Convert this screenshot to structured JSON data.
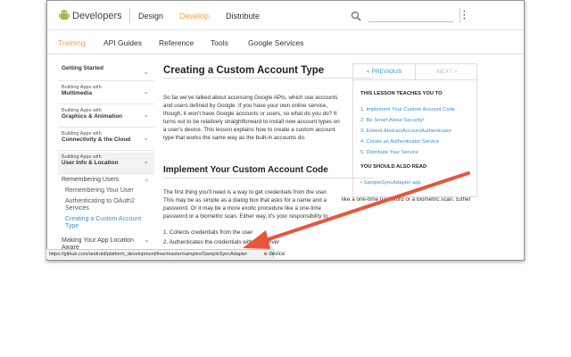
{
  "header": {
    "brand": "Developers",
    "nav": [
      "Design",
      "Develop",
      "Distribute"
    ],
    "active_nav": "Develop"
  },
  "subnav": {
    "items": [
      "Training",
      "API Guides",
      "Reference",
      "Tools",
      "Google Services"
    ],
    "active": "Training"
  },
  "sidebar": {
    "sections": [
      {
        "label": "Getting Started"
      },
      {
        "small": "Building Apps with",
        "bold": "Multimedia"
      },
      {
        "small": "Building Apps with",
        "bold": "Graphics & Animation"
      },
      {
        "small": "Building Apps with",
        "bold": "Connectivity & the Cloud"
      },
      {
        "small": "Building Apps with",
        "bold": "User Info & Location"
      }
    ],
    "sub_header": "Remembering Users",
    "sub_items": [
      "Remembering Your User",
      "Authenticating to OAuth2 Services",
      "Creating a Custom Account Type"
    ],
    "last": "Making Your App Location Aware"
  },
  "content": {
    "title": "Creating a Custom Account Type",
    "intro": "So far we've talked about accessing Google APIs, which use accounts and users defined by Google. If you have your own online service, though, it won't have Google accounts or users, so what do you do? It turns out to be relatively straightforward to install new account types on a user's device. This lesson explains how to create a custom account type that works the same way as the built-in accounts do.",
    "h2": "Implement Your Custom Account Code",
    "para2": "The first thing you'll need is a way to get credentials from the user. This may be as simple as a dialog box that asks for a name and a password. Or it may be a more exotic procedure like a one-time password or a biometric scan. Either way, it's your responsibility to implement the code that",
    "line_tail1": "like a one-time password or a biometric scan. Either",
    "list": [
      "1.  Collects credentials from the user",
      "2.  Authenticates the credentials with the server"
    ],
    "list_tail": "e device"
  },
  "right_panel": {
    "prev": "< PREVIOUS",
    "next": "NEXT >",
    "lesson_title": "THIS LESSON TEACHES YOU TO",
    "lessons": [
      "1.  Implement Your Custom Account Code",
      "2.  Be Smart About Security!",
      "3.  Extend AbstractAccountAuthenticator",
      "4.  Create an Authenticator Service",
      "5.  Distribute Your Service"
    ],
    "also_read_title": "YOU SHOULD ALSO READ",
    "also_read": [
      "•  SampleSyncAdapter app"
    ]
  },
  "status": {
    "url": "https://github.com/android/platform_development/tree/master/samples/SampleSyncAdapter"
  },
  "colors": {
    "accent_orange": "#f1a244",
    "link_blue": "#3a8ed8",
    "arrow_red": "#e8553c",
    "android_green": "#97c03e"
  },
  "icons": [
    "android-logo-icon",
    "search-icon",
    "overflow-menu-icon",
    "chevron-down-icon",
    "arrow-annotation-icon"
  ]
}
